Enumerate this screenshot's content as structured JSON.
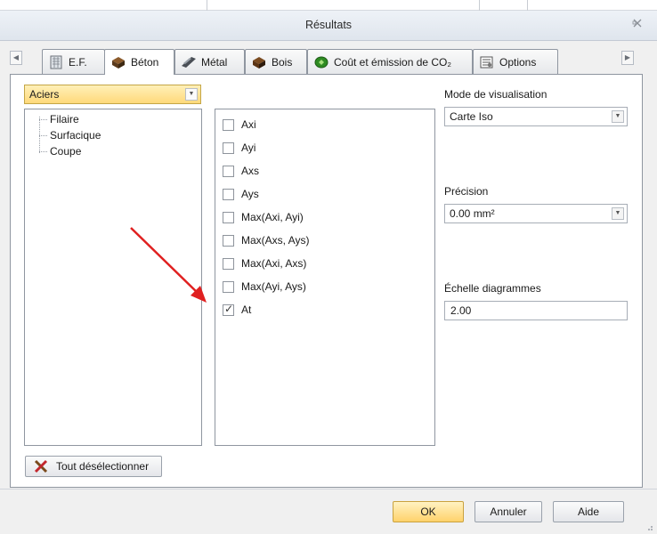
{
  "window": {
    "title": "Résultats"
  },
  "tabs": [
    {
      "label": "E.F."
    },
    {
      "label": "Béton"
    },
    {
      "label": "Métal"
    },
    {
      "label": "Bois"
    },
    {
      "label": "Coût et émission de CO₂"
    },
    {
      "label": "Options"
    }
  ],
  "active_tab": "Béton",
  "type_combo": {
    "value": "Aciers"
  },
  "tree": {
    "items": [
      "Filaire",
      "Surfacique",
      "Coupe"
    ],
    "selected": "Surfacique"
  },
  "components": [
    {
      "label": "Axi",
      "checked": false
    },
    {
      "label": "Ayi",
      "checked": false
    },
    {
      "label": "Axs",
      "checked": false
    },
    {
      "label": "Ays",
      "checked": false
    },
    {
      "label": "Max(Axi, Ayi)",
      "checked": false
    },
    {
      "label": "Max(Axs, Ays)",
      "checked": false
    },
    {
      "label": "Max(Axi, Axs)",
      "checked": false
    },
    {
      "label": "Max(Ayi, Ays)",
      "checked": false
    },
    {
      "label": "At",
      "checked": true
    }
  ],
  "mode": {
    "label": "Mode de visualisation",
    "value": "Carte Iso"
  },
  "precision": {
    "label": "Précision",
    "value": "0.00 mm²"
  },
  "scale": {
    "label": "Échelle diagrammes",
    "value": "2.00"
  },
  "buttons": {
    "deselect_all": "Tout désélectionner",
    "ok": "OK",
    "cancel": "Annuler",
    "help": "Aide"
  },
  "colors": {
    "annotation_arrow": "#e02020",
    "accent_yellow": "#ffd97a"
  },
  "icons": {
    "ef_tab": "fe-mesh-icon",
    "beton_tab": "concrete-block-icon",
    "metal_tab": "steel-beam-icon",
    "bois_tab": "wood-block-icon",
    "cost_tab": "money-icon",
    "options_tab": "options-icon",
    "deselect": "cross-icon"
  }
}
